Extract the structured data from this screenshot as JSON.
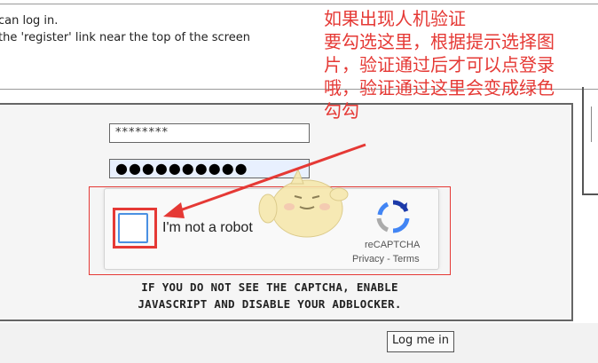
{
  "notice": {
    "line1": " can log in.",
    "line2": "the 'register' link near the top of the screen"
  },
  "form": {
    "username_value": "********",
    "password_value": "●●●●●●●●●●"
  },
  "recaptcha": {
    "checkbox_label": "I'm not a robot",
    "brand": "reCAPTCHA",
    "privacy": "Privacy",
    "separator": " - ",
    "terms": "Terms",
    "accent_color": "#4a90e2"
  },
  "warning": {
    "line1": "IF YOU DO NOT SEE THE CAPTCHA, ENABLE",
    "line2": "JAVASCRIPT AND DISABLE YOUR ADBLOCKER."
  },
  "login_button": "Log me in",
  "annotation": {
    "color": "#e53935",
    "lines": [
      "如果出现人机验证",
      "要勾选这里，根据提示选择图",
      "片，验证通过后才可以点登录",
      "哦，验证通过这里会变成绿色",
      "勾勾"
    ]
  }
}
